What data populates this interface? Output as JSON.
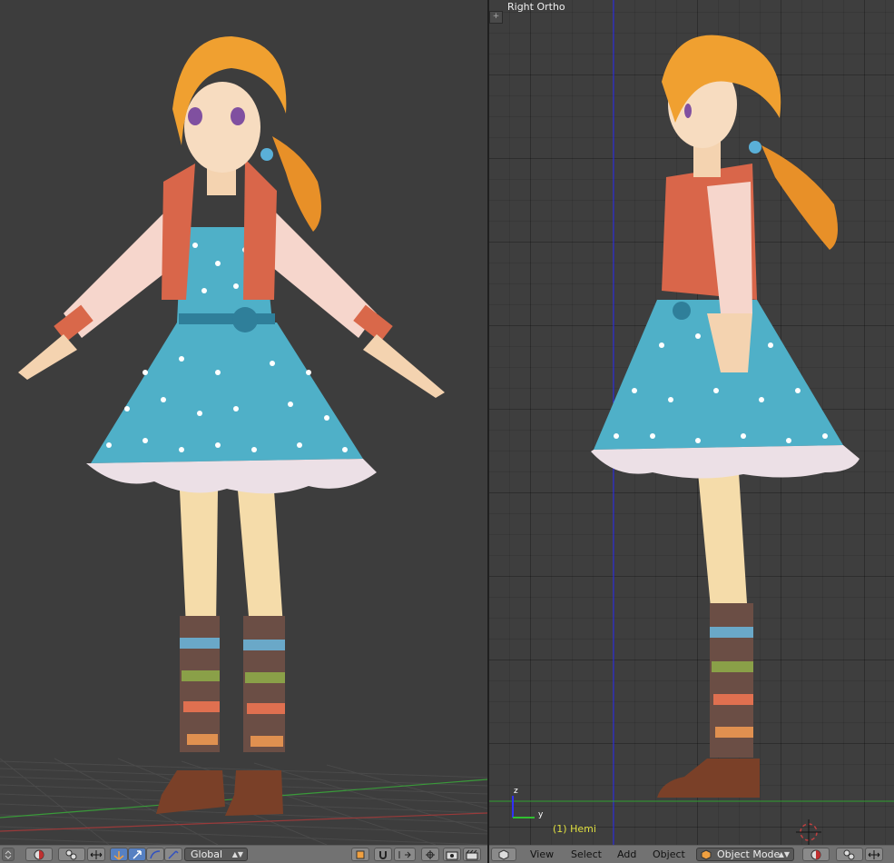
{
  "left_viewport": {
    "header": {
      "transform_orientation": "Global"
    }
  },
  "right_viewport": {
    "view_name": "Right Ortho",
    "object_info": "(1) Hemi",
    "axis_labels": {
      "z": "z",
      "y": "y"
    },
    "header": {
      "menus": [
        "View",
        "Select",
        "Add",
        "Object"
      ],
      "mode": "Object Mode"
    }
  },
  "colors": {
    "viewport_bg": "#3d3d3d",
    "header_bg": "#727272",
    "active_button": "#5680c2",
    "object_info_text": "#e0e040",
    "z_axis": "#3030ff",
    "y_axis": "#30c030"
  }
}
